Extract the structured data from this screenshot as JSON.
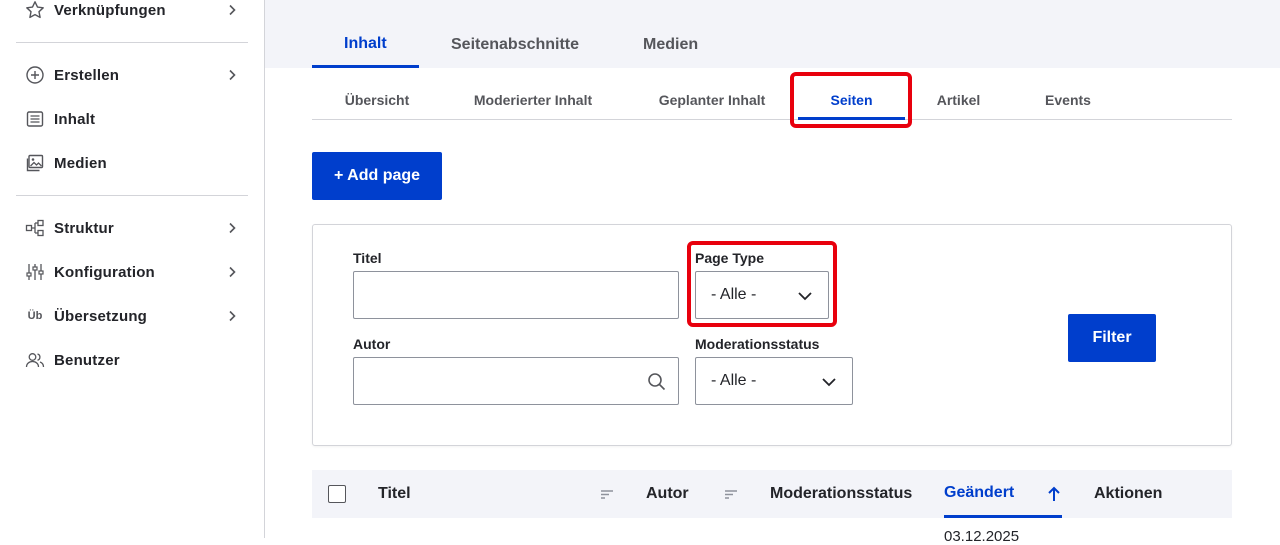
{
  "sidebar": {
    "items": [
      {
        "label": "Verknüpfungen",
        "icon": "star-icon"
      },
      {
        "label": "Erstellen",
        "icon": "plus-circle-icon"
      },
      {
        "label": "Inhalt",
        "icon": "document-list-icon"
      },
      {
        "label": "Medien",
        "icon": "image-icon"
      },
      {
        "label": "Struktur",
        "icon": "sitemap-icon"
      },
      {
        "label": "Konfiguration",
        "icon": "sliders-icon"
      },
      {
        "label": "Übersetzung",
        "icon": "translate-icon",
        "icon_text": "Üb"
      },
      {
        "label": "Benutzer",
        "icon": "users-icon"
      }
    ]
  },
  "primary_tabs": [
    {
      "label": "Inhalt",
      "active": true
    },
    {
      "label": "Seitenabschnitte",
      "active": false
    },
    {
      "label": "Medien",
      "active": false
    }
  ],
  "secondary_tabs": [
    {
      "label": "Übersicht",
      "active": false
    },
    {
      "label": "Moderierter Inhalt",
      "active": false
    },
    {
      "label": "Geplanter Inhalt",
      "active": false
    },
    {
      "label": "Seiten",
      "active": true
    },
    {
      "label": "Artikel",
      "active": false
    },
    {
      "label": "Events",
      "active": false
    }
  ],
  "add_button_label": "+ Add page",
  "filters": {
    "title_label": "Titel",
    "title_value": "",
    "page_type_label": "Page Type",
    "page_type_value": "- Alle -",
    "author_label": "Autor",
    "author_value": "",
    "moderation_label": "Moderationsstatus",
    "moderation_value": "- Alle -",
    "filter_button": "Filter"
  },
  "table": {
    "headers": [
      "Titel",
      "Autor",
      "Moderationsstatus",
      "Geändert",
      "Aktionen"
    ],
    "first_row_date": "03.12.2025"
  },
  "colors": {
    "accent": "#003ecc",
    "highlight": "#e8000d",
    "band": "#f3f4f9"
  }
}
